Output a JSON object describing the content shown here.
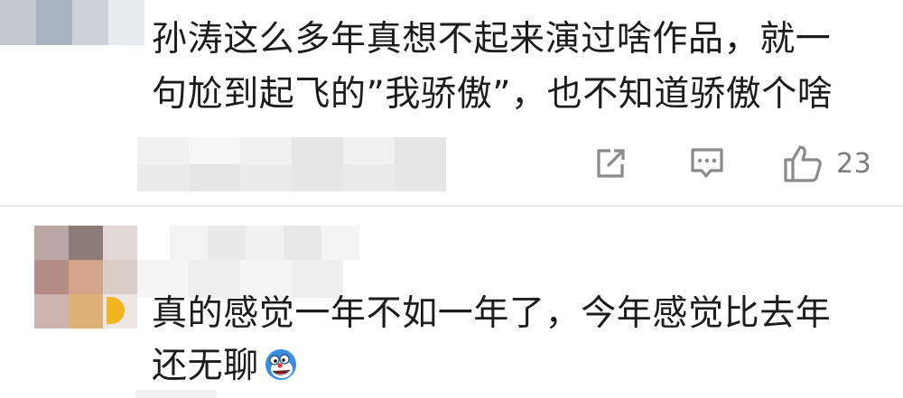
{
  "comments": [
    {
      "text_line1": "孙涛这么多年真想不起来演过啥作品，就一",
      "text_line2": "句尬到起飞的”我骄傲”，也不知道骄傲个啥",
      "actions": {
        "share_icon": "share-icon",
        "comment_icon": "comment-icon",
        "like_icon": "thumbs-up-icon",
        "like_count": "23"
      }
    },
    {
      "text_line1": "真的感觉一年不如一年了，今年感觉比去年",
      "text_line2": "还无聊",
      "emoji_icon": "grinning-blue-face-emoji"
    }
  ],
  "colors": {
    "text": "#1c1c1c",
    "icon": "#8a8a8a",
    "divider": "#ececec",
    "badge": "#f2b522"
  }
}
